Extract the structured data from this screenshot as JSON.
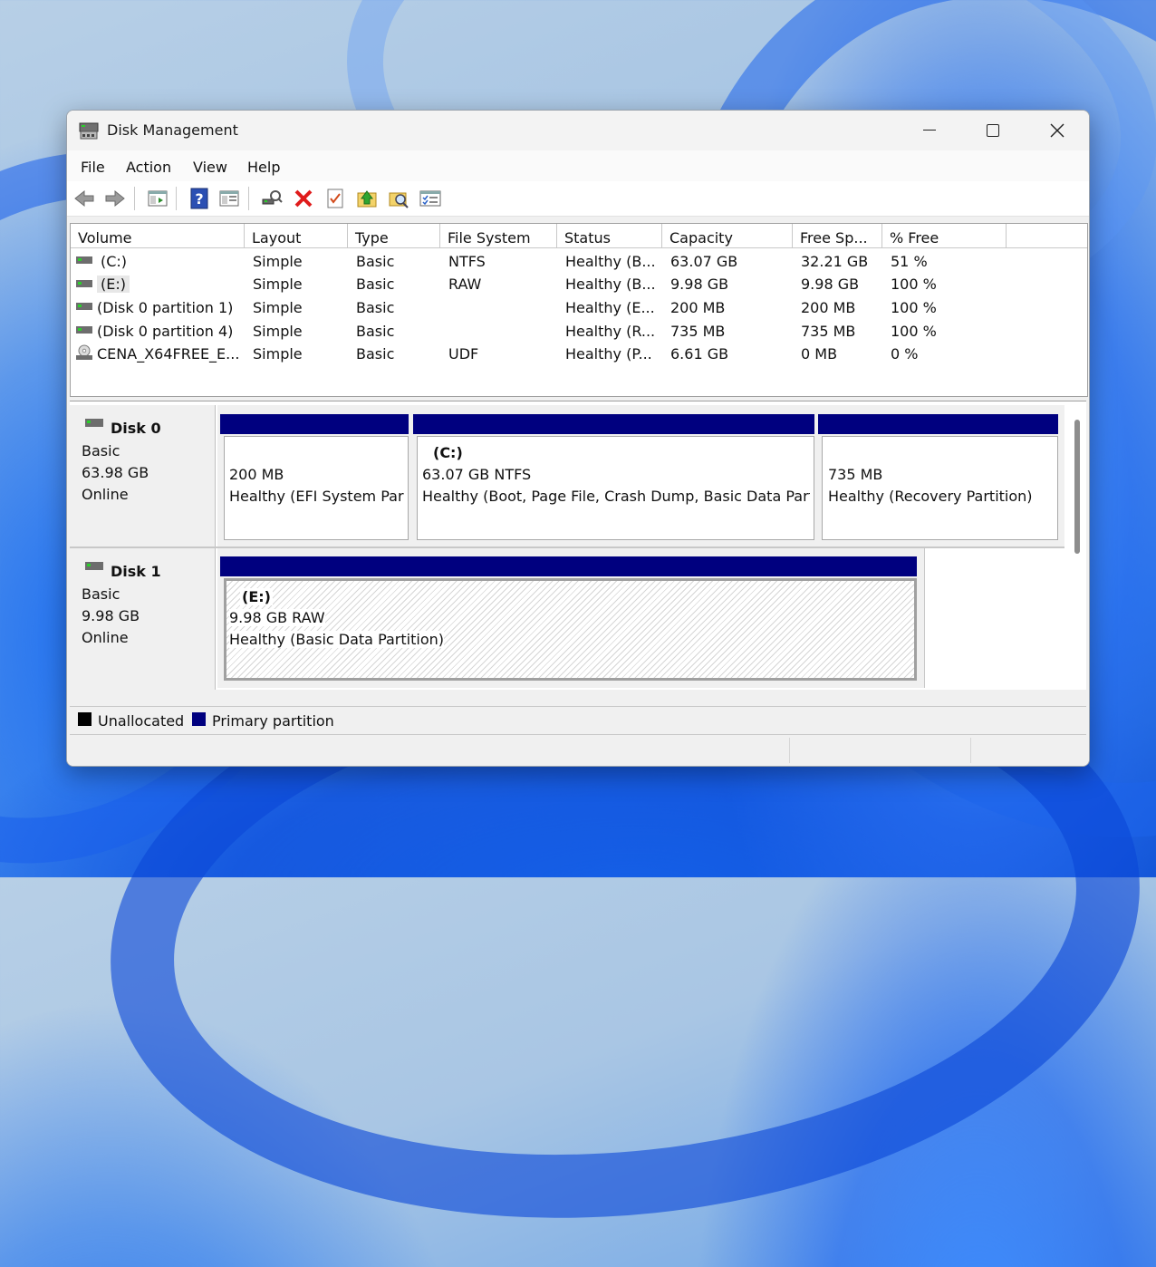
{
  "window": {
    "title": "Disk Management",
    "controls": {
      "minimize": "minimize",
      "maximize": "maximize",
      "close": "close"
    }
  },
  "menu": [
    "File",
    "Action",
    "View",
    "Help"
  ],
  "toolbar": {
    "icons": [
      "back-arrow-icon",
      "forward-arrow-icon",
      "console-tree-icon",
      "help-icon",
      "properties-icon",
      "connect-icon",
      "delete-icon",
      "checklist-icon",
      "up-folder-icon",
      "search-folder-icon",
      "settings-list-icon"
    ]
  },
  "volume_list": {
    "columns": [
      "Volume",
      "Layout",
      "Type",
      "File System",
      "Status",
      "Capacity",
      "Free Sp...",
      "% Free"
    ],
    "rows": [
      {
        "volume": "(C:)",
        "layout": "Simple",
        "type": "Basic",
        "fs": "NTFS",
        "status": "Healthy (B...",
        "capacity": "63.07 GB",
        "free": "32.21 GB",
        "pct": "51 %",
        "icon": "drive-icon"
      },
      {
        "volume": "(E:)",
        "layout": "Simple",
        "type": "Basic",
        "fs": "RAW",
        "status": "Healthy (B...",
        "capacity": "9.98 GB",
        "free": "9.98 GB",
        "pct": "100 %",
        "icon": "drive-icon"
      },
      {
        "volume": "(Disk 0 partition 1)",
        "layout": "Simple",
        "type": "Basic",
        "fs": "",
        "status": "Healthy (E...",
        "capacity": "200 MB",
        "free": "200 MB",
        "pct": "100 %",
        "icon": "drive-icon"
      },
      {
        "volume": "(Disk 0 partition 4)",
        "layout": "Simple",
        "type": "Basic",
        "fs": "",
        "status": "Healthy (R...",
        "capacity": "735 MB",
        "free": "735 MB",
        "pct": "100 %",
        "icon": "drive-icon"
      },
      {
        "volume": "CENA_X64FREE_E...",
        "layout": "Simple",
        "type": "Basic",
        "fs": "UDF",
        "status": "Healthy (P...",
        "capacity": "6.61 GB",
        "free": "0 MB",
        "pct": "0 %",
        "icon": "cd-drive-icon"
      }
    ]
  },
  "disks": [
    {
      "name": "Disk 0",
      "type": "Basic",
      "size": "63.98 GB",
      "state": "Online",
      "partitions": [
        {
          "title": "",
          "line1": "200 MB",
          "line2": "Healthy (EFI System Par"
        },
        {
          "title": "(C:)",
          "line1": "63.07 GB NTFS",
          "line2": "Healthy (Boot, Page File, Crash Dump, Basic Data Part"
        },
        {
          "title": "",
          "line1": "735 MB",
          "line2": "Healthy (Recovery Partition)"
        }
      ]
    },
    {
      "name": "Disk 1",
      "type": "Basic",
      "size": "9.98 GB",
      "state": "Online",
      "partitions": [
        {
          "title": "(E:)",
          "line1": "9.98 GB RAW",
          "line2": "Healthy (Basic Data Partition)"
        }
      ]
    }
  ],
  "legend": {
    "items": [
      {
        "label": "Unallocated",
        "color": "#000000"
      },
      {
        "label": "Primary partition",
        "color": "#00007f"
      }
    ]
  },
  "colors": {
    "partition_bar": "#00007f",
    "accent": "#0a5be0"
  }
}
